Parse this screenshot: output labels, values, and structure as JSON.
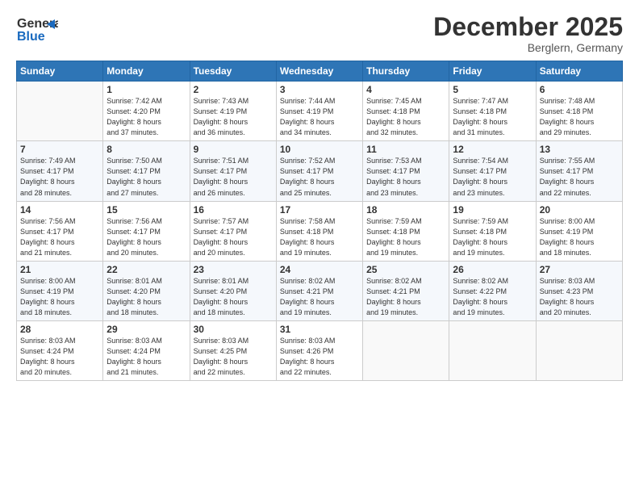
{
  "header": {
    "logo_line1": "General",
    "logo_line2": "Blue",
    "month": "December 2025",
    "location": "Berglern, Germany"
  },
  "weekdays": [
    "Sunday",
    "Monday",
    "Tuesday",
    "Wednesday",
    "Thursday",
    "Friday",
    "Saturday"
  ],
  "weeks": [
    [
      {
        "day": "",
        "sunrise": "",
        "sunset": "",
        "daylight": ""
      },
      {
        "day": "1",
        "sunrise": "Sunrise: 7:42 AM",
        "sunset": "Sunset: 4:20 PM",
        "daylight": "Daylight: 8 hours and 37 minutes."
      },
      {
        "day": "2",
        "sunrise": "Sunrise: 7:43 AM",
        "sunset": "Sunset: 4:19 PM",
        "daylight": "Daylight: 8 hours and 36 minutes."
      },
      {
        "day": "3",
        "sunrise": "Sunrise: 7:44 AM",
        "sunset": "Sunset: 4:19 PM",
        "daylight": "Daylight: 8 hours and 34 minutes."
      },
      {
        "day": "4",
        "sunrise": "Sunrise: 7:45 AM",
        "sunset": "Sunset: 4:18 PM",
        "daylight": "Daylight: 8 hours and 32 minutes."
      },
      {
        "day": "5",
        "sunrise": "Sunrise: 7:47 AM",
        "sunset": "Sunset: 4:18 PM",
        "daylight": "Daylight: 8 hours and 31 minutes."
      },
      {
        "day": "6",
        "sunrise": "Sunrise: 7:48 AM",
        "sunset": "Sunset: 4:18 PM",
        "daylight": "Daylight: 8 hours and 29 minutes."
      }
    ],
    [
      {
        "day": "7",
        "sunrise": "Sunrise: 7:49 AM",
        "sunset": "Sunset: 4:17 PM",
        "daylight": "Daylight: 8 hours and 28 minutes."
      },
      {
        "day": "8",
        "sunrise": "Sunrise: 7:50 AM",
        "sunset": "Sunset: 4:17 PM",
        "daylight": "Daylight: 8 hours and 27 minutes."
      },
      {
        "day": "9",
        "sunrise": "Sunrise: 7:51 AM",
        "sunset": "Sunset: 4:17 PM",
        "daylight": "Daylight: 8 hours and 26 minutes."
      },
      {
        "day": "10",
        "sunrise": "Sunrise: 7:52 AM",
        "sunset": "Sunset: 4:17 PM",
        "daylight": "Daylight: 8 hours and 25 minutes."
      },
      {
        "day": "11",
        "sunrise": "Sunrise: 7:53 AM",
        "sunset": "Sunset: 4:17 PM",
        "daylight": "Daylight: 8 hours and 23 minutes."
      },
      {
        "day": "12",
        "sunrise": "Sunrise: 7:54 AM",
        "sunset": "Sunset: 4:17 PM",
        "daylight": "Daylight: 8 hours and 23 minutes."
      },
      {
        "day": "13",
        "sunrise": "Sunrise: 7:55 AM",
        "sunset": "Sunset: 4:17 PM",
        "daylight": "Daylight: 8 hours and 22 minutes."
      }
    ],
    [
      {
        "day": "14",
        "sunrise": "Sunrise: 7:56 AM",
        "sunset": "Sunset: 4:17 PM",
        "daylight": "Daylight: 8 hours and 21 minutes."
      },
      {
        "day": "15",
        "sunrise": "Sunrise: 7:56 AM",
        "sunset": "Sunset: 4:17 PM",
        "daylight": "Daylight: 8 hours and 20 minutes."
      },
      {
        "day": "16",
        "sunrise": "Sunrise: 7:57 AM",
        "sunset": "Sunset: 4:17 PM",
        "daylight": "Daylight: 8 hours and 20 minutes."
      },
      {
        "day": "17",
        "sunrise": "Sunrise: 7:58 AM",
        "sunset": "Sunset: 4:18 PM",
        "daylight": "Daylight: 8 hours and 19 minutes."
      },
      {
        "day": "18",
        "sunrise": "Sunrise: 7:59 AM",
        "sunset": "Sunset: 4:18 PM",
        "daylight": "Daylight: 8 hours and 19 minutes."
      },
      {
        "day": "19",
        "sunrise": "Sunrise: 7:59 AM",
        "sunset": "Sunset: 4:18 PM",
        "daylight": "Daylight: 8 hours and 19 minutes."
      },
      {
        "day": "20",
        "sunrise": "Sunrise: 8:00 AM",
        "sunset": "Sunset: 4:19 PM",
        "daylight": "Daylight: 8 hours and 18 minutes."
      }
    ],
    [
      {
        "day": "21",
        "sunrise": "Sunrise: 8:00 AM",
        "sunset": "Sunset: 4:19 PM",
        "daylight": "Daylight: 8 hours and 18 minutes."
      },
      {
        "day": "22",
        "sunrise": "Sunrise: 8:01 AM",
        "sunset": "Sunset: 4:20 PM",
        "daylight": "Daylight: 8 hours and 18 minutes."
      },
      {
        "day": "23",
        "sunrise": "Sunrise: 8:01 AM",
        "sunset": "Sunset: 4:20 PM",
        "daylight": "Daylight: 8 hours and 18 minutes."
      },
      {
        "day": "24",
        "sunrise": "Sunrise: 8:02 AM",
        "sunset": "Sunset: 4:21 PM",
        "daylight": "Daylight: 8 hours and 19 minutes."
      },
      {
        "day": "25",
        "sunrise": "Sunrise: 8:02 AM",
        "sunset": "Sunset: 4:21 PM",
        "daylight": "Daylight: 8 hours and 19 minutes."
      },
      {
        "day": "26",
        "sunrise": "Sunrise: 8:02 AM",
        "sunset": "Sunset: 4:22 PM",
        "daylight": "Daylight: 8 hours and 19 minutes."
      },
      {
        "day": "27",
        "sunrise": "Sunrise: 8:03 AM",
        "sunset": "Sunset: 4:23 PM",
        "daylight": "Daylight: 8 hours and 20 minutes."
      }
    ],
    [
      {
        "day": "28",
        "sunrise": "Sunrise: 8:03 AM",
        "sunset": "Sunset: 4:24 PM",
        "daylight": "Daylight: 8 hours and 20 minutes."
      },
      {
        "day": "29",
        "sunrise": "Sunrise: 8:03 AM",
        "sunset": "Sunset: 4:24 PM",
        "daylight": "Daylight: 8 hours and 21 minutes."
      },
      {
        "day": "30",
        "sunrise": "Sunrise: 8:03 AM",
        "sunset": "Sunset: 4:25 PM",
        "daylight": "Daylight: 8 hours and 22 minutes."
      },
      {
        "day": "31",
        "sunrise": "Sunrise: 8:03 AM",
        "sunset": "Sunset: 4:26 PM",
        "daylight": "Daylight: 8 hours and 22 minutes."
      },
      {
        "day": "",
        "sunrise": "",
        "sunset": "",
        "daylight": ""
      },
      {
        "day": "",
        "sunrise": "",
        "sunset": "",
        "daylight": ""
      },
      {
        "day": "",
        "sunrise": "",
        "sunset": "",
        "daylight": ""
      }
    ]
  ]
}
